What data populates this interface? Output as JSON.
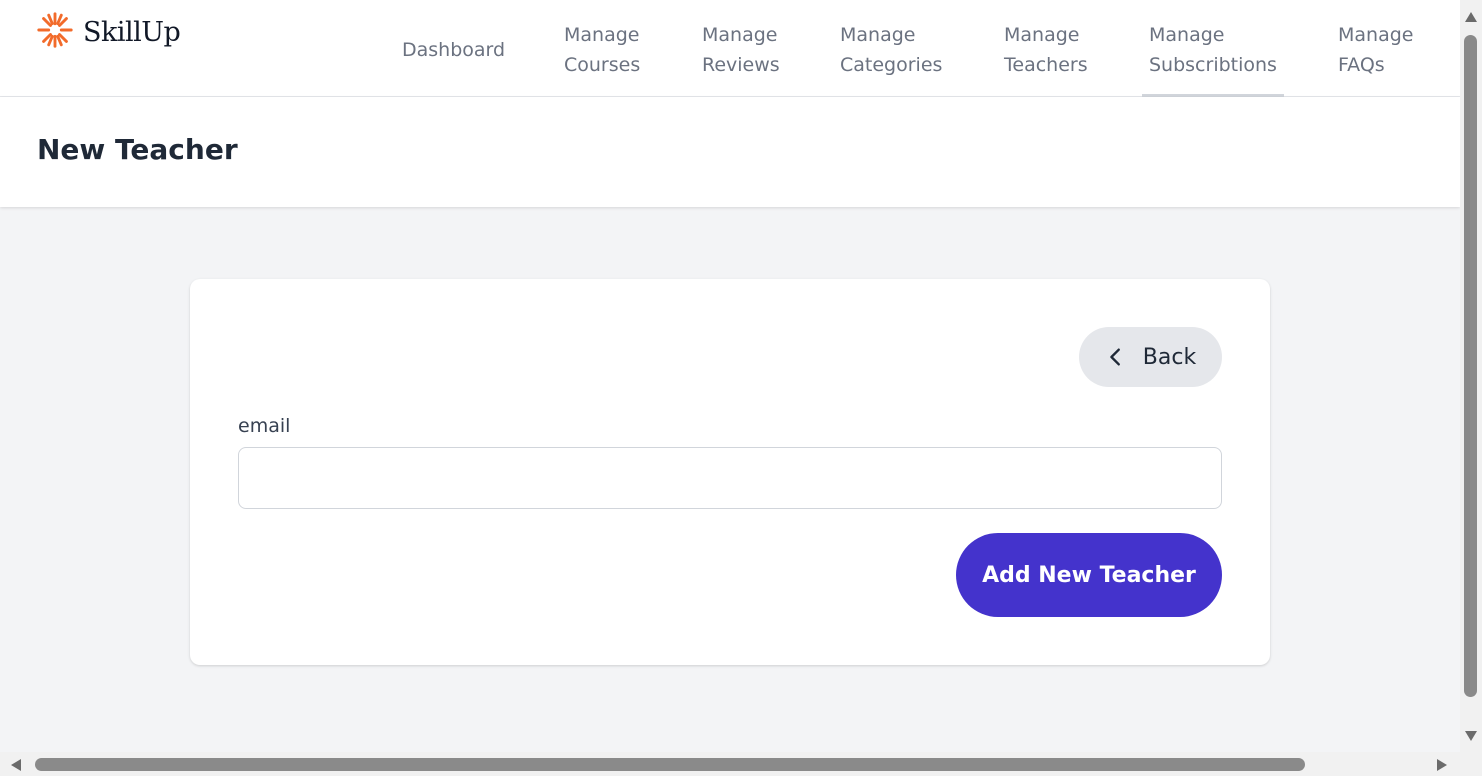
{
  "app": {
    "name": "SkillUp",
    "logo_icon": "sunburst-logo-icon",
    "logo_color": "#f26b2b"
  },
  "nav": {
    "items": [
      {
        "line1": "Dashboard",
        "line2": ""
      },
      {
        "line1": "Manage",
        "line2": "Courses"
      },
      {
        "line1": "Manage",
        "line2": "Reviews"
      },
      {
        "line1": "Manage",
        "line2": "Categories"
      },
      {
        "line1": "Manage",
        "line2": "Teachers"
      },
      {
        "line1": "Manage",
        "line2": "Subscribtions"
      },
      {
        "line1": "Manage",
        "line2": "FAQs"
      }
    ],
    "active_index": 5
  },
  "header": {
    "title": "New Teacher"
  },
  "form": {
    "back_label": "Back",
    "back_icon": "chevron-left-icon",
    "email_label": "email",
    "email_value": "",
    "email_placeholder": "",
    "submit_label": "Add New Teacher"
  },
  "colors": {
    "primary": "#4433cc",
    "back_button_bg": "#e5e7eb",
    "page_bg": "#f3f4f6"
  }
}
